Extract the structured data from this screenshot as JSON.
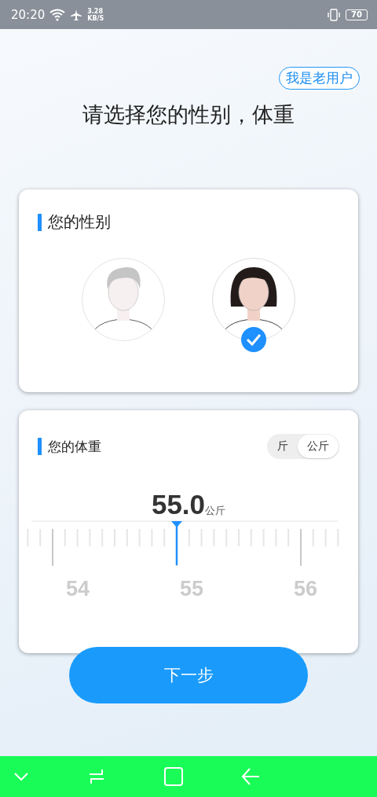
{
  "status_bar": {
    "time": "20:20",
    "speed_value": "3.28",
    "speed_unit": "KB/S",
    "battery": "70"
  },
  "returning_user_button": "我是老用户",
  "title": "请选择您的性别，体重",
  "gender_card": {
    "heading": "您的性别",
    "options": [
      {
        "kind": "male",
        "selected": false
      },
      {
        "kind": "female",
        "selected": true
      }
    ]
  },
  "weight_card": {
    "heading": "您的体重",
    "units": [
      {
        "label": "斤",
        "selected": false
      },
      {
        "label": "公斤",
        "selected": true
      }
    ],
    "value": "55.0",
    "value_unit": "公斤",
    "scale_labels": [
      "54",
      "55",
      "56"
    ]
  },
  "next_button": "下一步"
}
